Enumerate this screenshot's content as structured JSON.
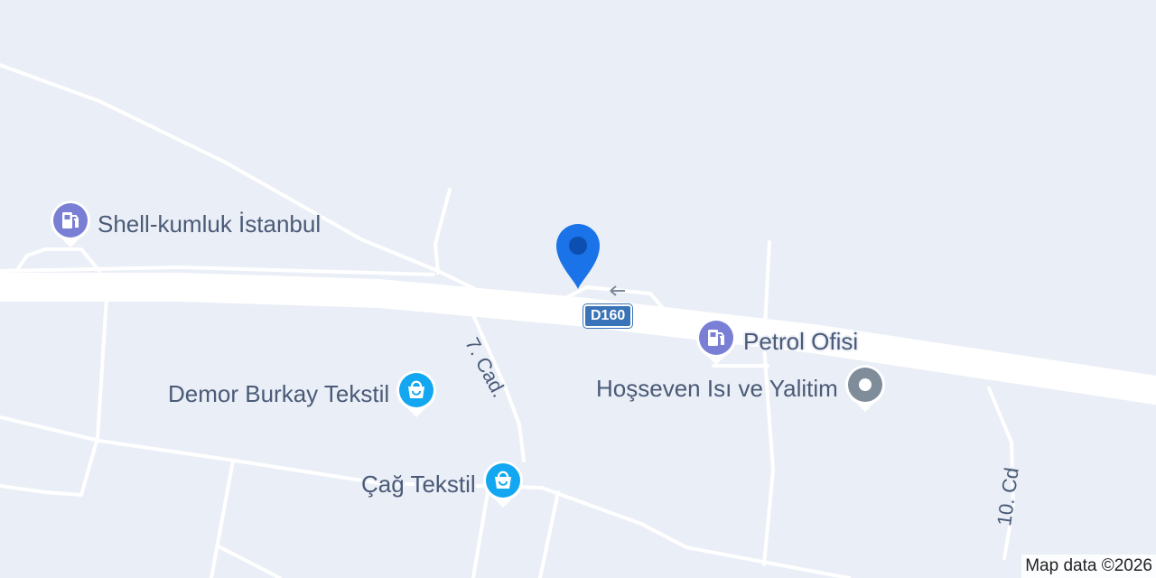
{
  "map": {
    "background": "#eaeef6",
    "road_color": "#ffffff",
    "label_color": "#4a5a77",
    "attribution": "Map data ©2026",
    "road_shield": {
      "text": "D160",
      "color": "#3a74b8"
    },
    "streets": [
      {
        "name": "7. Cad."
      },
      {
        "name": "10. Cd"
      }
    ],
    "pois": [
      {
        "name": "Shell-kumluk İstanbul",
        "category": "fuel",
        "icon": "gas-station-icon",
        "color": "#7a7fd6"
      },
      {
        "name": "Petrol Ofisi",
        "category": "fuel",
        "icon": "gas-station-icon",
        "color": "#7a7fd6"
      },
      {
        "name": "Demor Burkay Tekstil",
        "category": "shopping",
        "icon": "shopping-bag-icon",
        "color": "#12a7f0"
      },
      {
        "name": "Hoşseven Isı ve Yalitim",
        "category": "generic",
        "icon": "generic-place-icon",
        "color": "#7f8c99"
      },
      {
        "name": "Çağ Tekstil",
        "category": "shopping",
        "icon": "shopping-bag-icon",
        "color": "#12a7f0"
      }
    ],
    "location_pin": {
      "icon": "location-pin-icon",
      "color": "#1a73e8"
    }
  }
}
